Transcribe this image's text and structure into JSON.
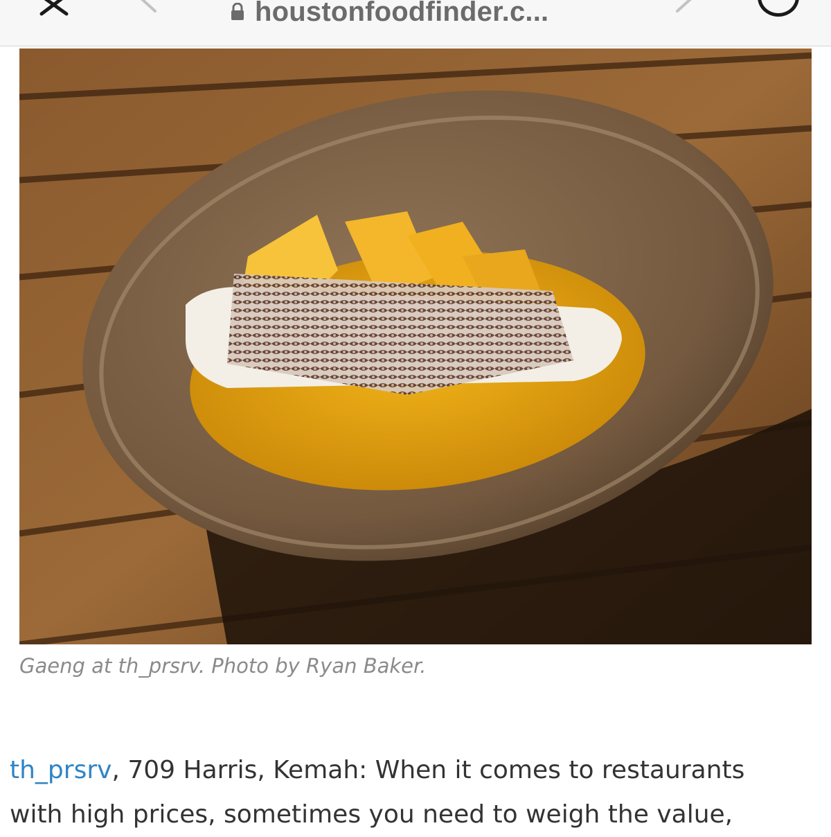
{
  "browser": {
    "url": "houstonfoodfinder.c...",
    "icons": {
      "close": "close-icon",
      "back": "chevron-left-icon",
      "forward": "chevron-right-icon",
      "lock": "lock-icon",
      "more": "more-icon"
    }
  },
  "article": {
    "photo_alt": "Gaeng at th_prsrv",
    "caption": "Gaeng at th_prsrv. Photo by Ryan Baker.",
    "paragraph": {
      "link_text": "th_prsrv",
      "line1_rest": ", 709 Harris, Kemah: When it comes to restaurants",
      "line2": "with high prices, sometimes you need to weigh the value,"
    }
  },
  "colors": {
    "link": "#2f84c6",
    "caption": "#8a8a8a",
    "body_text": "#333333"
  }
}
